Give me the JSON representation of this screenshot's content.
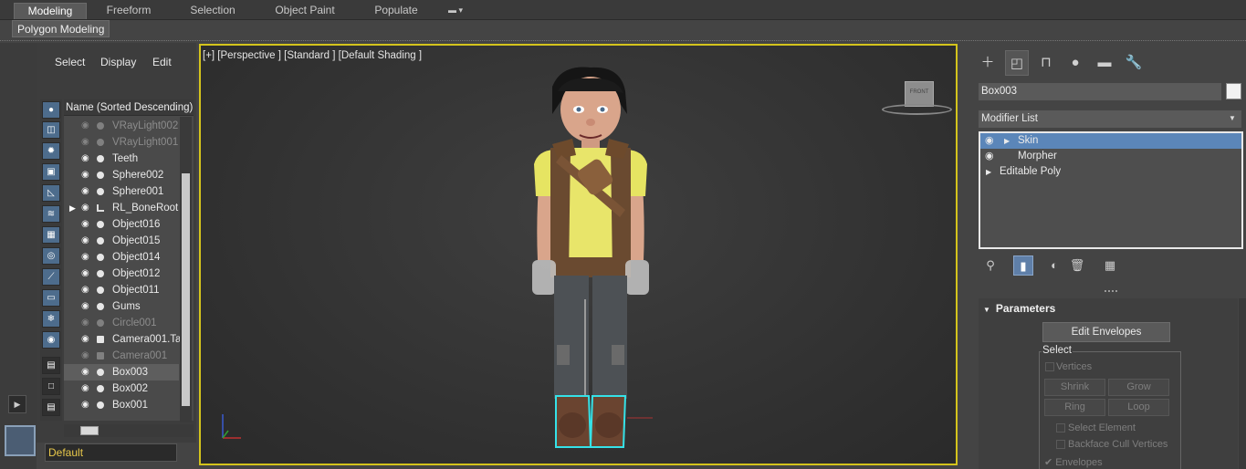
{
  "ribbon": {
    "tabs": [
      "Modeling",
      "Freeform",
      "Selection",
      "Object Paint",
      "Populate"
    ],
    "active_tab": "Modeling",
    "panel_button": "Polygon Modeling"
  },
  "explorer": {
    "menu": [
      "Select",
      "Display",
      "Edit"
    ],
    "column_header": "Name (Sorted Descending)",
    "rows": [
      {
        "name": "VRayLight002",
        "dim": true
      },
      {
        "name": "VRayLight001",
        "dim": true
      },
      {
        "name": "Teeth",
        "dim": false
      },
      {
        "name": "Sphere002",
        "dim": false
      },
      {
        "name": "Sphere001",
        "dim": false
      },
      {
        "name": "RL_BoneRoot",
        "dim": false
      },
      {
        "name": "Object016",
        "dim": false
      },
      {
        "name": "Object015",
        "dim": false
      },
      {
        "name": "Object014",
        "dim": false
      },
      {
        "name": "Object012",
        "dim": false
      },
      {
        "name": "Object011",
        "dim": false
      },
      {
        "name": "Gums",
        "dim": false
      },
      {
        "name": "Circle001",
        "dim": true
      },
      {
        "name": "Camera001.Ta",
        "dim": false
      },
      {
        "name": "Camera001",
        "dim": true
      },
      {
        "name": "Box003",
        "dim": false,
        "selected": true
      },
      {
        "name": "Box002",
        "dim": false
      },
      {
        "name": "Box001",
        "dim": false
      }
    ],
    "layer": "Default"
  },
  "viewport": {
    "label": "[+] [Perspective ] [Standard ] [Default Shading ]",
    "viewcube_text": "FRONT"
  },
  "command_panel": {
    "object_name": "Box003",
    "modifier_list": "Modifier List",
    "stack": [
      {
        "name": "Skin",
        "eye": true,
        "arrow": true,
        "selected": true
      },
      {
        "name": "Morpher",
        "eye": true,
        "arrow": false,
        "selected": false
      },
      {
        "name": "Editable Poly",
        "eye": false,
        "arrow": true,
        "selected": false
      }
    ],
    "rollout_title": "Parameters",
    "edit_envelopes": "Edit Envelopes",
    "select_group": "Select",
    "vertices": "Vertices",
    "shrink": "Shrink",
    "grow": "Grow",
    "ring": "Ring",
    "loop": "Loop",
    "select_element": "Select Element",
    "backface_cull": "Backface Cull Vertices",
    "envelopes": "Envelopes"
  },
  "colors": {
    "accent_blue": "#5b86b9",
    "viewport_border": "#d4c41c",
    "layer_text": "#e8c84a"
  }
}
